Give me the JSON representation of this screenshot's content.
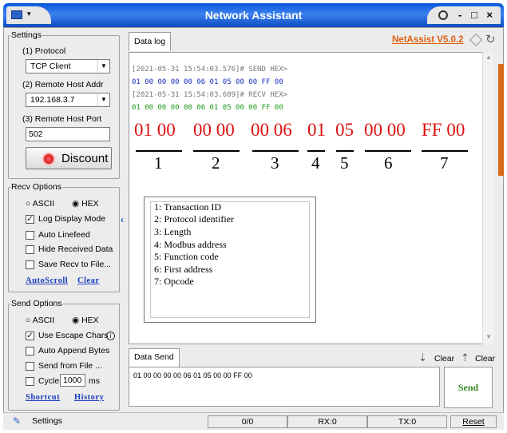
{
  "window": {
    "title": "Network Assistant",
    "version": "NetAssist V5.0.2",
    "controls": "- □ ×"
  },
  "settings": {
    "legend": "Settings",
    "protocol_label": "(1) Protocol",
    "protocol_value": "TCP Client",
    "host_label": "(2) Remote Host Addr",
    "host_value": "192.168.3.7",
    "port_label": "(3) Remote Host Port",
    "port_value": "502",
    "disconnect_label": "Discount"
  },
  "recv_options": {
    "legend": "Recv Options",
    "ascii": "ASCII",
    "hex": "HEX",
    "items": [
      {
        "label": "Log Display Mode",
        "checked": true
      },
      {
        "label": "Auto Linefeed",
        "checked": false
      },
      {
        "label": "Hide Received Data",
        "checked": false
      },
      {
        "label": "Save Recv to File...",
        "checked": false
      }
    ],
    "autoscroll": "AutoScroll",
    "clear": "Clear"
  },
  "send_options": {
    "legend": "Send Options",
    "ascii": "ASCII",
    "hex": "HEX",
    "escape": "Use Escape Chars",
    "append": "Auto Append Bytes",
    "from_file": "Send from File ...",
    "cycle": "Cycle",
    "cycle_value": "1000",
    "ms": "ms",
    "shortcut": "Shortcut",
    "history": "History"
  },
  "log": {
    "tab": "Data log",
    "lines": [
      {
        "text": "[2021-05-31 15:54:03.576]# SEND HEX>",
        "color": "#777777"
      },
      {
        "text": "01 00 00 00 00 06 01 05 00 00 FF 00",
        "color": "#1a2fc0"
      },
      {
        "text": "[2021-05-31 15:54:03.609]# RECV HEX>",
        "color": "#777777"
      },
      {
        "text": "01 00 00 00 00 06 01 05 00 00 FF 00",
        "color": "#1f9a1f"
      }
    ]
  },
  "annotation": {
    "groups": [
      "01 00",
      "00 00",
      "00 06",
      "01",
      "05",
      "00 00",
      "FF 00"
    ],
    "numbers": [
      "1",
      "2",
      "3",
      "4",
      "5",
      "6",
      "7"
    ],
    "legend": [
      "1: Transaction ID",
      "2: Protocol identifier",
      "3: Length",
      "4: Modbus address",
      "5: Function code",
      "6: First address",
      "7: Opcode"
    ]
  },
  "send": {
    "tab": "Data Send",
    "clear1": "Clear",
    "clear2": "Clear",
    "text": "01 00 00 00 00 06 01 05 00 00 FF 00",
    "button": "Send"
  },
  "status": {
    "settings": "Settings",
    "count": "0/0",
    "rx": "RX:0",
    "tx": "TX:0",
    "reset": "Reset"
  },
  "colors": {
    "title_bar": "#2a6ee8",
    "hex_red": "#d11111",
    "version_orange": "#e06010",
    "send_green": "#3a8a2a"
  }
}
